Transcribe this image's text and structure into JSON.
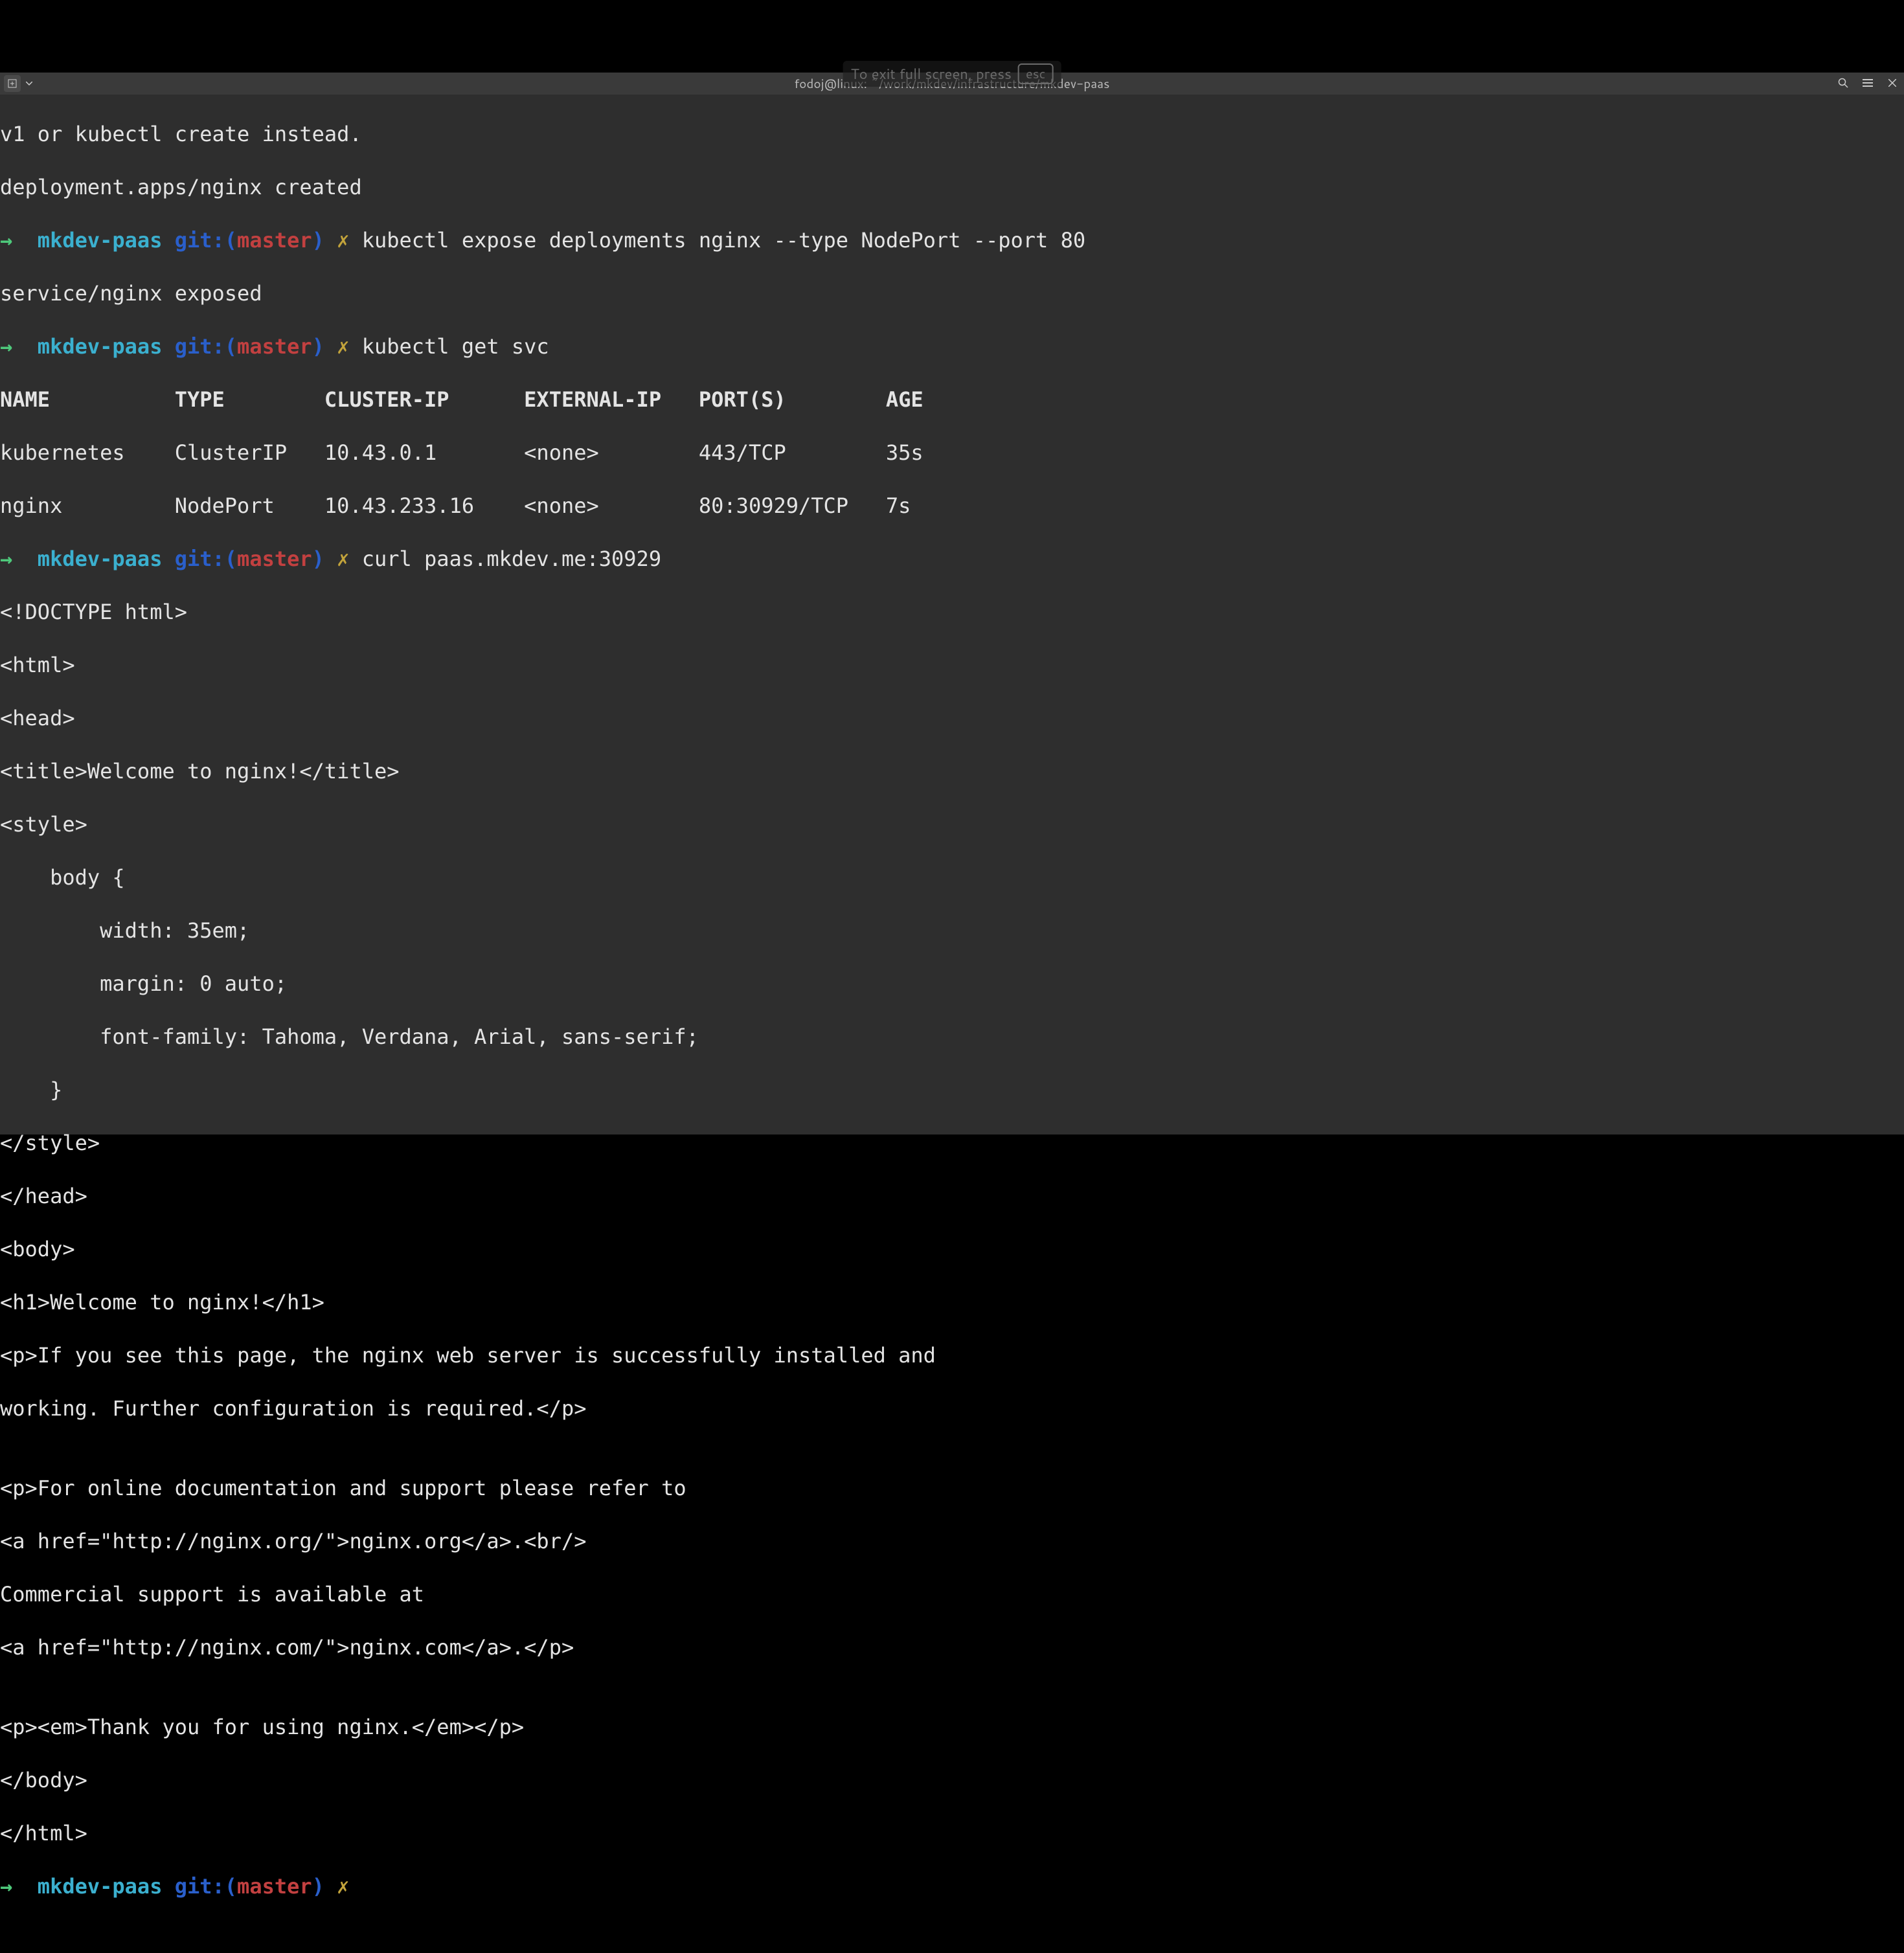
{
  "window": {
    "title": "fodoj@linux: ~/work/mkdev/infrastructure/mkdev-paas",
    "fullscreen_hint": "To exit full screen, press",
    "esc_label": "esc"
  },
  "prompt": {
    "arrow": "→",
    "dir": "mkdev-paas",
    "git_label": "git:(",
    "branch": "master",
    "git_close": ")",
    "dirty": "✗"
  },
  "lines": {
    "l01": "v1 or kubectl create instead.",
    "l02": "deployment.apps/nginx created",
    "cmd1": "kubectl expose deployments nginx --type NodePort --port 80",
    "l03": "service/nginx exposed",
    "cmd2": "kubectl get svc",
    "svc_header": "NAME          TYPE        CLUSTER-IP      EXTERNAL-IP   PORT(S)        AGE",
    "svc_row1": "kubernetes    ClusterIP   10.43.0.1       <none>        443/TCP        35s",
    "svc_row2": "nginx         NodePort    10.43.233.16    <none>        80:30929/TCP   7s",
    "cmd3": "curl paas.mkdev.me:30929",
    "h01": "<!DOCTYPE html>",
    "h02": "<html>",
    "h03": "<head>",
    "h04": "<title>Welcome to nginx!</title>",
    "h05": "<style>",
    "h06": "    body {",
    "h07": "        width: 35em;",
    "h08": "        margin: 0 auto;",
    "h09": "        font-family: Tahoma, Verdana, Arial, sans-serif;",
    "h10": "    }",
    "h11": "</style>",
    "h12": "</head>",
    "h13": "<body>",
    "h14": "<h1>Welcome to nginx!</h1>",
    "h15": "<p>If you see this page, the nginx web server is successfully installed and",
    "h16": "working. Further configuration is required.</p>",
    "h17": "",
    "h18": "<p>For online documentation and support please refer to",
    "h19": "<a href=\"http://nginx.org/\">nginx.org</a>.<br/>",
    "h20": "Commercial support is available at",
    "h21": "<a href=\"http://nginx.com/\">nginx.com</a>.</p>",
    "h22": "",
    "h23": "<p><em>Thank you for using nginx.</em></p>",
    "h24": "</body>",
    "h25": "</html>"
  }
}
